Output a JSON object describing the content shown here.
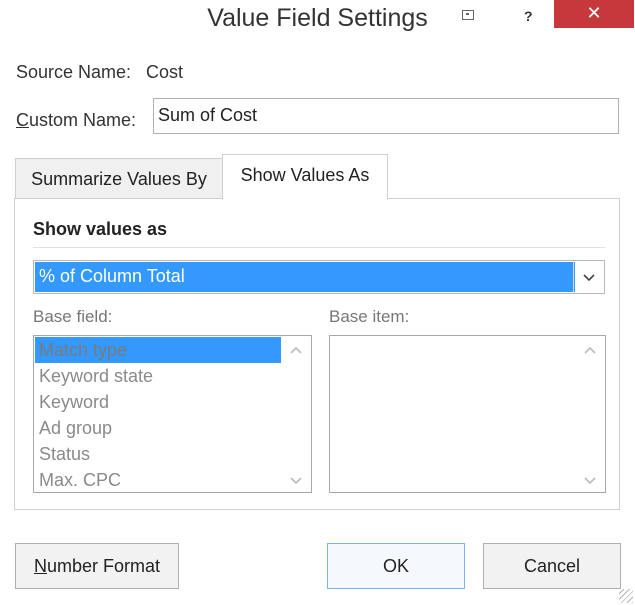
{
  "window": {
    "title": "Value Field Settings",
    "help_label": "?",
    "close_label": "✕"
  },
  "source": {
    "label": "Source Name:",
    "value": "Cost"
  },
  "custom_name": {
    "label": "Custom Name:",
    "value": "Sum of Cost"
  },
  "tabs": [
    {
      "label": "Summarize Values By",
      "active": false
    },
    {
      "label": "Show Values As",
      "active": true
    }
  ],
  "show_values": {
    "section_title": "Show values as",
    "selected": "% of Column Total",
    "dropdown_icon": "chevron-down-icon"
  },
  "base_field": {
    "label": "Base field:",
    "items": [
      "Match type",
      "Keyword state",
      "Keyword",
      "Ad group",
      "Status",
      "Max. CPC"
    ],
    "selected_index": 0
  },
  "base_item": {
    "label": "Base item:",
    "items": []
  },
  "buttons": {
    "number_format": "Number Format",
    "ok": "OK",
    "cancel": "Cancel"
  },
  "colors": {
    "selection": "#3399ff",
    "close_button": "#c7383b"
  }
}
